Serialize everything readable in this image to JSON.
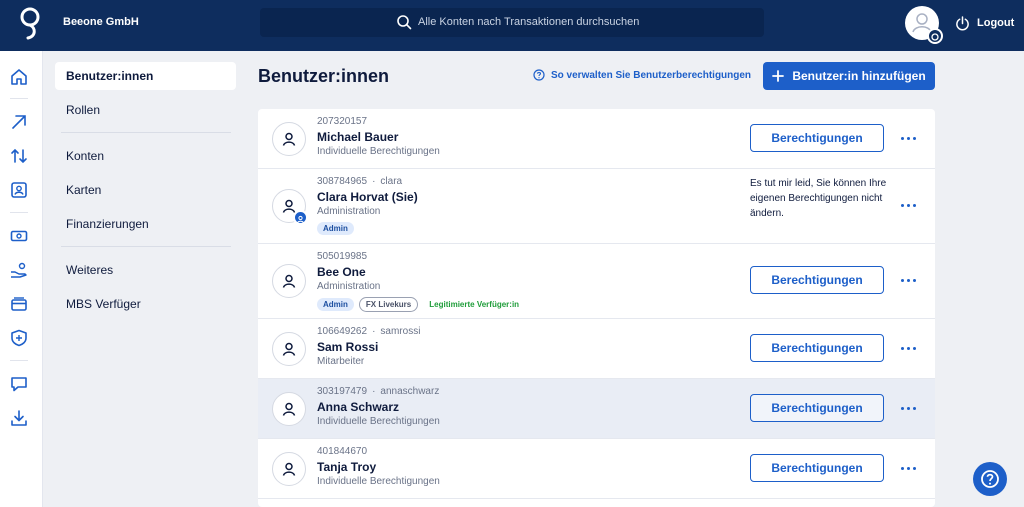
{
  "header": {
    "company": "Beeone GmbH",
    "search_placeholder": "Alle Konten nach Transaktionen durchsuchen",
    "logout_label": "Logout"
  },
  "rail": {
    "icons": [
      "home-icon",
      "arrow-up-right-icon",
      "transfer-icon",
      "contact-card-icon",
      "banknote-icon",
      "hand-coin-icon",
      "cards-icon",
      "shield-icon",
      "chat-icon",
      "download-icon"
    ]
  },
  "subnav": {
    "items": [
      {
        "label": "Benutzer:innen",
        "active": true
      },
      {
        "label": "Rollen"
      },
      {
        "label": "Konten"
      },
      {
        "label": "Karten"
      },
      {
        "label": "Finanzierungen"
      },
      {
        "label": "Weiteres"
      },
      {
        "label": "MBS Verfüger"
      }
    ]
  },
  "main": {
    "title": "Benutzer:innen",
    "help_link": "So verwalten Sie Benutzerberechtigungen",
    "add_button": "Benutzer:in hinzufügen",
    "permissions_label": "Berechtigungen",
    "users": [
      {
        "id": "207320157",
        "username": "",
        "name": "Michael Bauer",
        "role": "Individuelle Berechtigungen",
        "tags": []
      },
      {
        "id": "308784965",
        "username": "clara",
        "name": "Clara Horvat (Sie)",
        "role": "Administration",
        "tags": [
          "Admin"
        ],
        "note": "Es tut mir leid, Sie können Ihre eigenen Berechtigungen nicht ändern."
      },
      {
        "id": "505019985",
        "username": "",
        "name": "Bee One",
        "role": "Administration",
        "tags": [
          "Admin",
          "FX Livekurs",
          "Legitimierte Verfüger:in"
        ]
      },
      {
        "id": "106649262",
        "username": "samrossi",
        "name": "Sam Rossi",
        "role": "Mitarbeiter",
        "tags": []
      },
      {
        "id": "303197479",
        "username": "annaschwarz",
        "name": "Anna Schwarz",
        "role": "Individuelle Berechtigungen",
        "tags": [],
        "highlighted": true
      },
      {
        "id": "401844670",
        "username": "",
        "name": "Tanja Troy",
        "role": "Individuelle Berechtigungen",
        "tags": []
      }
    ]
  },
  "colors": {
    "topbar": "#0e2d5e",
    "accent": "#1d5fc9",
    "tag_green": "#1f9d3a"
  }
}
